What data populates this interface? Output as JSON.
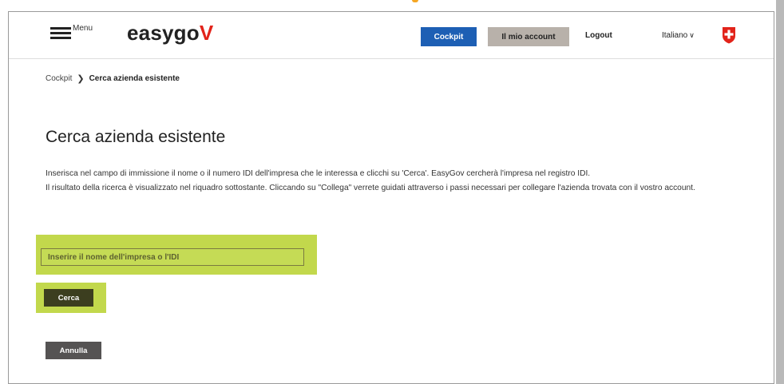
{
  "header": {
    "menu_label": "Menu",
    "logo_text": "easygo",
    "logo_accent": "V",
    "cockpit_label": "Cockpit",
    "account_label": "Il mio account",
    "logout_label": "Logout",
    "language_label": "Italiano",
    "language_chevron": "∨"
  },
  "breadcrumb": {
    "root": "Cockpit",
    "separator": "❯",
    "current": "Cerca azienda esistente"
  },
  "main": {
    "title": "Cerca azienda esistente",
    "description_line1": "Inserisca nel campo di immissione il nome o il numero IDI dell'impresa che le interessa e clicchi su 'Cerca'. EasyGov cercherà l'impresa nel registro IDI.",
    "description_line2": "Il risultato della ricerca è visualizzato nel riquadro sottostante. Cliccando su \"Collega\" verrete guidati attraverso i passi necessari per collegare l'azienda trovata con il vostro account.",
    "search": {
      "placeholder": "Inserire il nome dell'impresa o l'IDI",
      "value": ""
    },
    "search_button": "Cerca",
    "cancel_button": "Annulla"
  },
  "icons": {
    "menu": "hamburger-icon",
    "chevron": "chevron-down-icon",
    "breadcrumb_separator": "chevron-right-icon",
    "country": "swiss-cross-icon"
  },
  "colors": {
    "cockpit_button": "#1d5fb4",
    "account_button": "#b8b1aa",
    "logo_accent": "#e2231a",
    "highlight": "#c2d84c",
    "search_button": "#3c3e1f",
    "cancel_button": "#555353",
    "swiss_red": "#e2231a"
  }
}
